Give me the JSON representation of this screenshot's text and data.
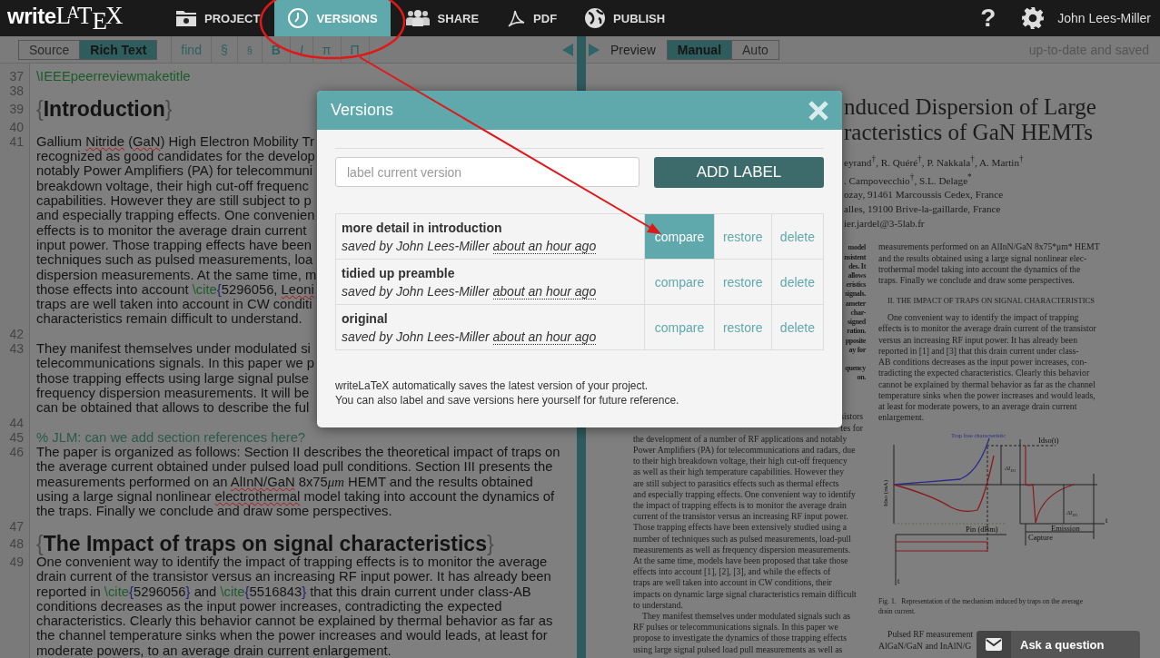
{
  "nav": {
    "logo": "**write**L$^{A}$T$_{E}$X",
    "items": [
      {
        "label": "PROJECT",
        "kind": "project",
        "selected": false
      },
      {
        "label": "VERSIONS",
        "kind": "versions",
        "selected": true
      },
      {
        "label": "SHARE",
        "kind": "share",
        "selected": false
      },
      {
        "label": "PDF",
        "kind": "pdf",
        "selected": false
      },
      {
        "label": "PUBLISH",
        "kind": "publish",
        "selected": false
      }
    ],
    "help": "?",
    "user": "John Lees-Miller"
  },
  "editor_toolbar": {
    "modes": [
      {
        "label": "Source",
        "selected": false
      },
      {
        "label": "Rich Text",
        "selected": true
      }
    ],
    "tools": [
      {
        "label": "find",
        "kind": "text"
      },
      {
        "label": "§",
        "kind": "section"
      },
      {
        "label": "§",
        "kind": "subsection"
      },
      {
        "label": "B",
        "kind": "bold"
      },
      {
        "label": "I",
        "kind": "italic"
      },
      {
        "label": "π",
        "kind": "symbol"
      },
      {
        "label": "Π",
        "kind": "symbol"
      }
    ]
  },
  "editor": {
    "lines": [
      {
        "number": "37",
        "kind": "code",
        "rows": [
          {
            "spans": [
              "\\IEEEpeerreviewmaketitle"
            ]
          }
        ]
      },
      {
        "number": "38",
        "kind": "blank"
      },
      {
        "number": "39",
        "kind": "heading",
        "rows": [
          {
            "spans": [
              {
                "text": "{",
                "kind": "brace"
              },
              "Introduction",
              {
                "text": "}",
                "kind": "brace"
              }
            ]
          }
        ]
      },
      {
        "number": "40",
        "kind": "blank"
      },
      {
        "number": "41",
        "kind": "para",
        "rows": [
          {
            "spans": [
              "Gallium ",
              {
                "text": "Nitride",
                "kind": "misspelled"
              },
              " (",
              {
                "text": "GaN",
                "kind": "misspelled"
              },
              ") High Electron Mobility Tr"
            ]
          },
          {
            "spans": [
              "recognized as good candidates for the develop"
            ]
          },
          {
            "spans": [
              "notably Power Amplifiers (PA) for telecommuni"
            ]
          },
          {
            "spans": [
              "breakdown voltage, their high cut-off frequenc"
            ]
          },
          {
            "spans": [
              "capabilities. However they are still subject to p"
            ]
          },
          {
            "spans": [
              "and especially trapping effects. One convenien"
            ]
          },
          {
            "spans": [
              "effects is to monitor the average drain current"
            ]
          },
          {
            "spans": [
              "input power. Those trapping effects have been"
            ]
          },
          {
            "spans": [
              "techniques such as pulsed measurements, loa"
            ]
          },
          {
            "spans": [
              "dispersion measurements. At the same time, m"
            ]
          },
          {
            "spans": [
              "those effects into account ",
              {
                "text": "\\cite",
                "kind": "cmd"
              },
              {
                "text": "{",
                "kind": "cite_brace"
              },
              "5296056, ",
              {
                "text": "Leoni",
                "kind": "misspelled"
              }
            ]
          },
          {
            "spans": [
              "traps are well taken into account in CW conditi"
            ]
          },
          {
            "spans": [
              "characteristics remain difficult to understand."
            ]
          }
        ]
      },
      {
        "number": "42",
        "kind": "blank"
      },
      {
        "number": "43",
        "kind": "para",
        "rows": [
          {
            "spans": [
              "They manifest themselves under modulated si"
            ]
          },
          {
            "spans": [
              "telecommunications signals. In this paper we p"
            ]
          },
          {
            "spans": [
              "those trapping effects using large signal pulse"
            ]
          },
          {
            "spans": [
              "frequency dispersion measurements. It will be"
            ]
          },
          {
            "spans": [
              "can be obtained that allows to describe the ful"
            ]
          }
        ]
      },
      {
        "number": "44",
        "kind": "blank"
      },
      {
        "number": "45",
        "kind": "comment",
        "rows": [
          {
            "spans": [
              "% JLM: can we add section references here?"
            ]
          }
        ]
      },
      {
        "number": "46",
        "kind": "para",
        "rows": [
          {
            "spans": [
              "The paper is organized as follows: Section II describes the theoretical impact of traps on"
            ]
          },
          {
            "spans": [
              "the average current obtained under pulsed load pull conditions. Section III presents the"
            ]
          },
          {
            "spans": [
              "measurements performed on an ",
              {
                "text": "AlInN/GaN",
                "kind": "misspelled"
              },
              " 8x75",
              {
                "text": "μm",
                "kind": "math"
              },
              " HEMT and the results obtained"
            ]
          },
          {
            "spans": [
              "using a large signal nonlinear ",
              {
                "text": "electrothermal",
                "kind": "misspelled"
              },
              " model taking into account the dynamics of"
            ]
          },
          {
            "spans": [
              "the traps. Finally we conclude and draw some perspectives."
            ]
          }
        ]
      },
      {
        "number": "47",
        "kind": "blank"
      },
      {
        "number": "48",
        "kind": "heading",
        "rows": [
          {
            "spans": [
              {
                "text": "{",
                "kind": "brace"
              },
              "The Impact of traps on signal characteristics",
              {
                "text": "}",
                "kind": "brace"
              }
            ]
          }
        ]
      },
      {
        "number": "49",
        "kind": "para",
        "rows": [
          {
            "spans": [
              "One convenient way to identify the impact of trapping effects is to monitor the average"
            ]
          },
          {
            "spans": [
              "drain current of the transistor versus an increasing RF input power. It has already been"
            ]
          },
          {
            "spans": [
              "reported in ",
              {
                "text": "\\cite",
                "kind": "cmd"
              },
              {
                "text": "{",
                "kind": "cite_brace"
              },
              "5296056",
              {
                "text": "}",
                "kind": "cite_brace"
              },
              " and ",
              {
                "text": "\\cite",
                "kind": "cmd"
              },
              {
                "text": "{",
                "kind": "cite_brace"
              },
              "5516843",
              {
                "text": "}",
                "kind": "cite_brace"
              },
              " that this drain current under class-AB"
            ]
          },
          {
            "spans": [
              "conditions decreases as the input power increases, contradicting the expected"
            ]
          },
          {
            "spans": [
              "characteristics. Clearly this behavior cannot be explained by thermal behavior as far as"
            ]
          },
          {
            "spans": [
              "the channel temperature sinks when the power increases and would leads, at least for"
            ]
          },
          {
            "spans": [
              "moderate powers, to an average drain current enlargement."
            ]
          }
        ]
      }
    ]
  },
  "preview_toolbar": {
    "label": "Preview",
    "modes": [
      {
        "label": "Manual",
        "selected": true
      },
      {
        "label": "Auto",
        "selected": false
      }
    ],
    "status": "up-to-date and saved"
  },
  "pdf": {
    "title": [
      "nduced Dispersion of Large",
      "racteristics of GaN HEMTs"
    ],
    "authors": [
      "eyrand$^{†}$, R. Quéré$^{†}$, P. Nakkala$^{†}$, A. Martin$^{†}$",
      ". Campovecchio$^{†}$, S.L. Delage$^{*}$",
      "ozay, 91461 Marcoussis Cedex, France",
      "alles, 19100 Brive-la-gaillarde, France",
      "ier.jardel@3-5lab.fr"
    ],
    "abstract_fragments": [
      "model",
      "nsistent",
      "des. It",
      "allows",
      "eristics",
      "signals.",
      "ameter",
      "char-",
      "signed",
      "ration.",
      "pposite",
      "ay for"
    ],
    "abstract_fragments_2": [
      "quency",
      "on."
    ],
    "left_fragments": [
      "sistors",
      "tes for"
    ],
    "left_column": [
      "the development of a number of RF applications and notably",
      "Power Amplifiers (PA) for telecommunications and radars, due",
      "to their high breakdown voltage, their high cut-off frequency",
      "as well as their high temperature capabilities. However they",
      "are still subject to parasitics effects such as thermal effects",
      "and especially trapping effects. One convenient way to identify",
      "the impact of trapping effects is to monitor the average drain",
      "current of the transistor versus an increasing RF input power.",
      "Those trapping effects have been extensively studied using a",
      "number of techniques such as pulsed measurements, load-pull",
      "measurements as well as frequency dispersion measurements.",
      "At the same time, models have been proposed that take those",
      "effects into account [1], [2], [3], and while the effects of",
      "traps are well taken into account in CW conditions, their",
      "impacts on dynamic large signal characteristics remain difficult",
      "to understand."
    ],
    "left_column_2": [
      "They manifest themselves under modulated signals such as",
      "RF pulses or telecommunications signals. In this paper we",
      "propose to investigate the dynamics of those trapping effects",
      "using large signal pulsed load pull measurements as well as"
    ],
    "right_column": [
      "measurements performed on an AlInN/GaN 8x75*μm* HEMT",
      "and the results obtained using a large signal nonlinear elec-",
      "trothermal model taking into account the dynamics of the",
      "traps. Finally we conclude and draw some perspectives."
    ],
    "section_heading": "II. THE IMPACT OF TRAPS ON SIGNAL CHARACTERISTICS",
    "right_column_2": [
      "One convenient way to identify the impact of trapping",
      "effects is to monitor the average drain current of the transistor",
      "versus an increasing RF input power. It has already been",
      "reported in [1] and [3] that this drain current under class-",
      "AB conditions decreases as the input power increases, con-",
      "tradicting the expected characteristics. Clearly this behavior",
      "cannot be explained by thermal behavior as far as the channel",
      "temperature sinks when the power increases and would leads,",
      "at least for moderate powers, to an average drain current",
      "enlargement."
    ],
    "figure": {
      "trap_free_label": "Trap free characteristic",
      "current_label": "Idso(t)",
      "y_label": "Idso (mA)",
      "x_label": "Pin (dBm)",
      "time_label": "t",
      "time_label_2": "t",
      "emission_label": "Emission",
      "capture_label": "Capture",
      "delta_labels": [
        {
          "main": "ΔI",
          "sub": "D1"
        },
        {
          "main": "ΔI",
          "sub": "D1"
        }
      ]
    },
    "caption": [
      "Fig. 1.   Representation of the mechanism induced by traps on the average",
      "drain current."
    ],
    "right_column_3": [
      "Pulsed RF measurement",
      "AlGaN/GaN and InAlN/G"
    ]
  },
  "dialog": {
    "title": "Versions",
    "label_placeholder": "label current version",
    "add_button": "ADD LABEL",
    "versions": [
      {
        "label": "more detail in introduction",
        "saved_by": "saved by John Lees-Miller",
        "time": "about an hour ago",
        "actions": [
          {
            "label": "compare",
            "selected": true
          },
          {
            "label": "restore",
            "selected": false
          },
          {
            "label": "delete",
            "selected": false
          }
        ]
      },
      {
        "label": "tidied up preamble",
        "saved_by": "saved by John Lees-Miller",
        "time": "about an hour ago",
        "actions": [
          {
            "label": "compare",
            "selected": false
          },
          {
            "label": "restore",
            "selected": false
          },
          {
            "label": "delete",
            "selected": false
          }
        ]
      },
      {
        "label": "original",
        "saved_by": "saved by John Lees-Miller",
        "time": "about an hour ago",
        "actions": [
          {
            "label": "compare",
            "selected": false
          },
          {
            "label": "restore",
            "selected": false
          },
          {
            "label": "delete",
            "selected": false
          }
        ]
      }
    ],
    "notes": [
      "writeLaTeX automatically saves the latest version of your project.",
      "You can also label and save versions here yourself for future reference."
    ]
  },
  "ask": "Ask a question"
}
